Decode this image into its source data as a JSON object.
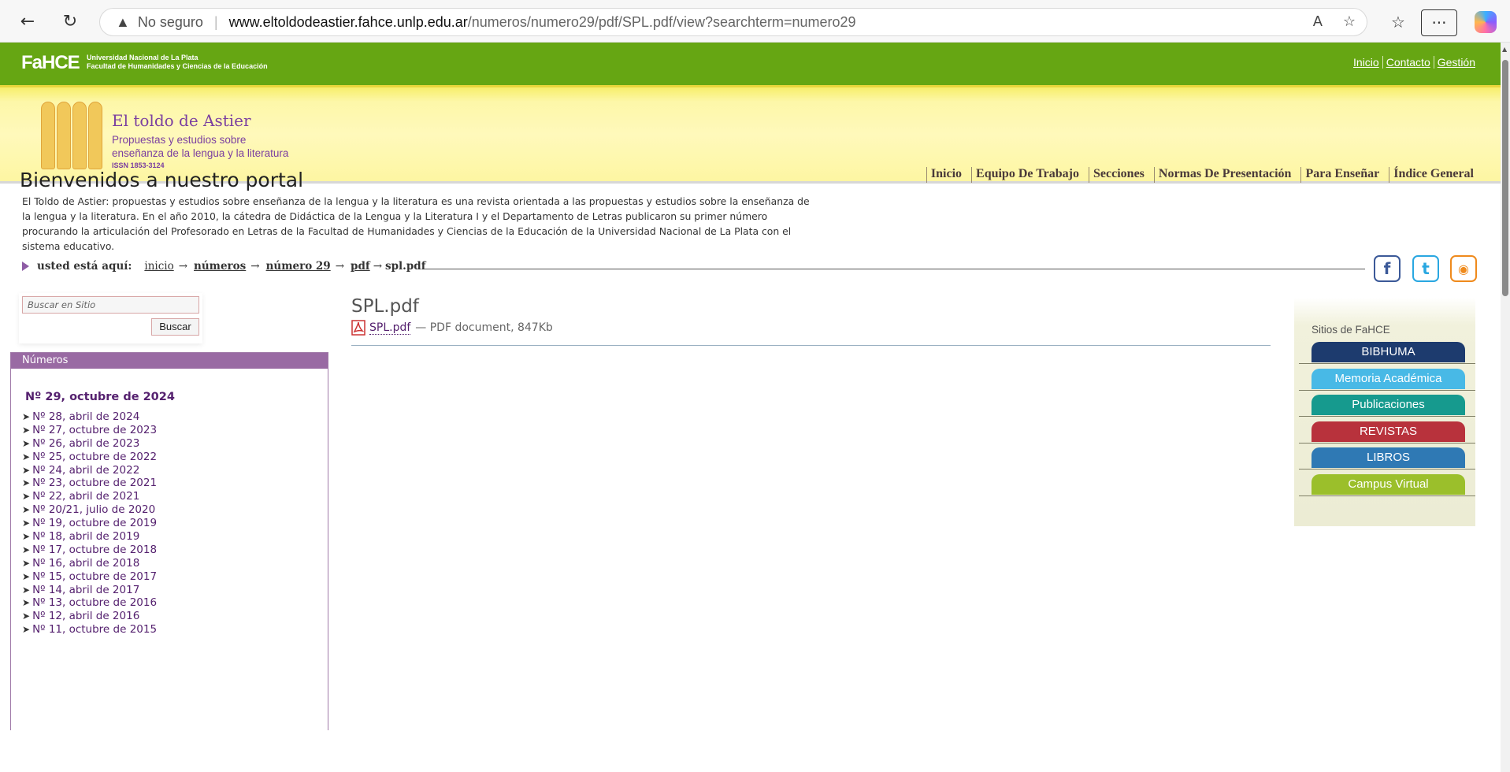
{
  "browser": {
    "security_label": "No seguro",
    "url_host": "www.eltoldodeastier.fahce.unlp.edu.ar",
    "url_path": "/numeros/numero29/pdf/SPL.pdf/view?searchterm=numero29"
  },
  "topbar": {
    "logo": "FaHCE",
    "university": "Universidad Nacional de La Plata",
    "faculty": "Facultad de Humanidades y Ciencias de la Educación",
    "links": [
      "Inicio",
      "Contacto",
      "Gestión"
    ]
  },
  "banner": {
    "title": "El toldo de Astier",
    "subtitle_1": "Propuestas y estudios sobre",
    "subtitle_2": "enseñanza de la lengua y la literatura",
    "issn": "ISSN 1853-3124"
  },
  "mainnav": [
    "Inicio",
    "Equipo De Trabajo",
    "Secciones",
    "Normas De Presentación",
    "Para Enseñar",
    "Índice General"
  ],
  "welcome": {
    "title": "Bienvenidos a nuestro portal",
    "text": "El Toldo de Astier: propuestas y estudios sobre enseñanza de la lengua y la literatura es una revista orientada a las propuestas y estudios sobre la enseñanza de la lengua y la literatura. En el año 2010, la cátedra de Didáctica de la Lengua y la Literatura I y el Departamento de Letras publicaron su primer número procurando la articulación del Profesorado en Letras de la Facultad de Humanidades y Ciencias de la Educación de la Universidad Nacional de La Plata con el sistema educativo."
  },
  "breadcrumb": {
    "label": "usted está aquí:",
    "items": [
      "inicio",
      "números",
      "número 29",
      "pdf"
    ],
    "current": "spl.pdf",
    "arrow": "→"
  },
  "search": {
    "placeholder": "Buscar en Sitio",
    "button": "Buscar"
  },
  "numeros": {
    "title": "Números",
    "current": "Nº 29, octubre de 2024",
    "items": [
      "Nº 28, abril de 2024",
      "Nº 27, octubre de 2023",
      "Nº 26, abril de 2023",
      "Nº 25, octubre de 2022",
      "Nº 24, abril de 2022",
      "Nº 23, octubre de 2021",
      "Nº 22, abril de 2021",
      "Nº 20/21, julio de 2020",
      "Nº 19, octubre de 2019",
      "Nº 18, abril de 2019",
      "Nº 17, octubre de 2018",
      "Nº 16, abril de 2018",
      "Nº 15, octubre de 2017",
      "Nº 14, abril de 2017",
      "Nº 13, octubre de 2016",
      "Nº 12, abril de 2016",
      "Nº 11, octubre de 2015"
    ]
  },
  "document": {
    "title": "SPL.pdf",
    "link": "SPL.pdf",
    "meta": "— PDF document, 847Kb"
  },
  "sitios": {
    "title": "Sitios de FaHCE",
    "buttons": [
      {
        "label": "BIBHUMA",
        "color": "#1d3b6e"
      },
      {
        "label": "Memoria Académica",
        "color": "#48b9e6"
      },
      {
        "label": "Publicaciones",
        "color": "#169a8e"
      },
      {
        "label": "REVISTAS",
        "color": "#b8323c"
      },
      {
        "label": "LIBROS",
        "color": "#2f79b4"
      },
      {
        "label": "Campus Virtual",
        "color": "#9bbf2b"
      }
    ]
  },
  "colors": {
    "topbar": "#66a613",
    "accent_purple": "#55216f",
    "panel_purple": "#996aa3"
  }
}
